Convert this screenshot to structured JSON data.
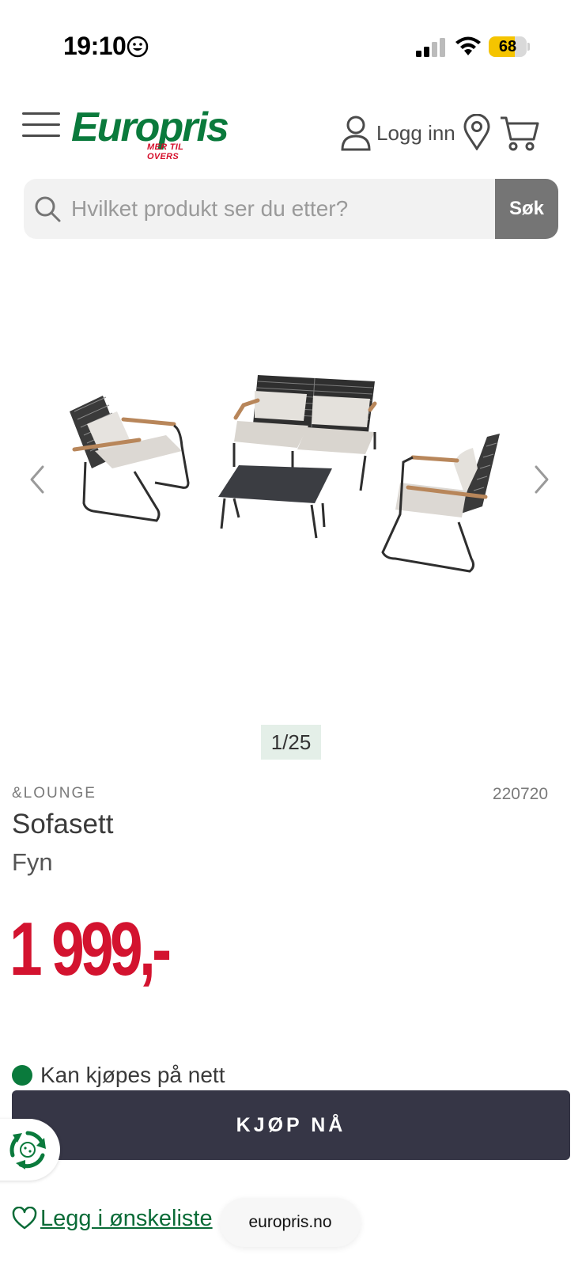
{
  "status_bar": {
    "time": "19:10",
    "battery": "68",
    "battery_level": 0.68
  },
  "header": {
    "logo_text": "Europris",
    "logo_tagline": "MER TIL OVERS",
    "login_label": "Logg inn",
    "icons": [
      "menu-icon",
      "user-icon",
      "location-pin-icon",
      "cart-icon"
    ]
  },
  "search": {
    "placeholder": "Hvilket produkt ser du etter?",
    "button_label": "Søk"
  },
  "gallery": {
    "counter": "1/25"
  },
  "product": {
    "brand": "&LOUNGE",
    "sku": "220720",
    "name": "Sofasett",
    "variant": "Fyn",
    "price": "1 999,-",
    "availability": "Kan kjøpes på nett",
    "buy_label": "KJØP NÅ",
    "wishlist_label": "Legg i ønskeliste"
  },
  "browser": {
    "url": "europris.no"
  },
  "colors": {
    "brand_green": "#0a7a3c",
    "price_red": "#d3132f",
    "buy_button": "#363646",
    "battery_yellow": "#f5c400"
  }
}
